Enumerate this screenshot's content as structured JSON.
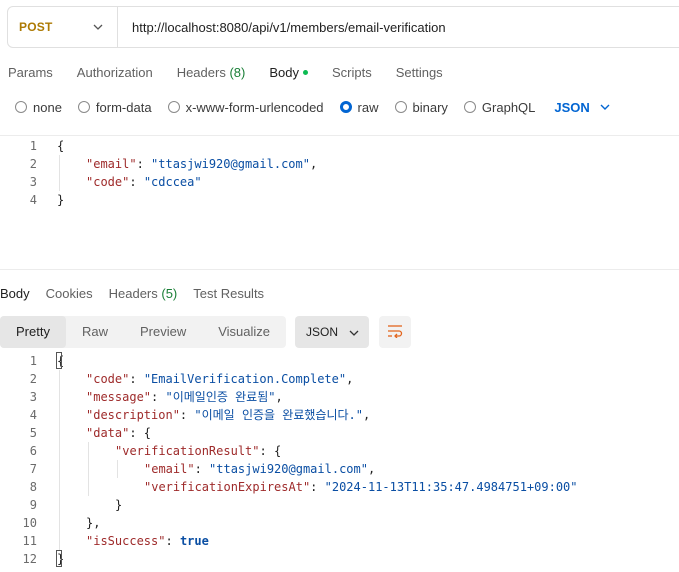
{
  "request": {
    "method": "POST",
    "url": "http://localhost:8080/api/v1/members/email-verification"
  },
  "request_tabs": [
    {
      "label": "Params",
      "active": false
    },
    {
      "label": "Authorization",
      "active": false
    },
    {
      "label": "Headers",
      "count": "(8)",
      "active": false
    },
    {
      "label": "Body",
      "active": true
    },
    {
      "label": "Scripts",
      "active": false
    },
    {
      "label": "Settings",
      "active": false
    }
  ],
  "body_types": [
    {
      "label": "none",
      "checked": false
    },
    {
      "label": "form-data",
      "checked": false
    },
    {
      "label": "x-www-form-urlencoded",
      "checked": false
    },
    {
      "label": "raw",
      "checked": true
    },
    {
      "label": "binary",
      "checked": false
    },
    {
      "label": "GraphQL",
      "checked": false
    }
  ],
  "body_language": "JSON",
  "request_body_lines": [
    {
      "num": "1",
      "indent": 0,
      "tokens": [
        {
          "t": "p",
          "v": "{"
        }
      ]
    },
    {
      "num": "2",
      "indent": 1,
      "tokens": [
        {
          "t": "k",
          "v": "\"email\""
        },
        {
          "t": "p",
          "v": ": "
        },
        {
          "t": "s",
          "v": "\"ttasjwi920@gmail.com\""
        },
        {
          "t": "p",
          "v": ","
        }
      ]
    },
    {
      "num": "3",
      "indent": 1,
      "tokens": [
        {
          "t": "k",
          "v": "\"code\""
        },
        {
          "t": "p",
          "v": ": "
        },
        {
          "t": "s",
          "v": "\"cdccea\""
        }
      ]
    },
    {
      "num": "4",
      "indent": 0,
      "tokens": [
        {
          "t": "p",
          "v": "}"
        }
      ]
    }
  ],
  "response_tabs": [
    {
      "label": "Body",
      "active": true
    },
    {
      "label": "Cookies",
      "active": false
    },
    {
      "label": "Headers",
      "count": "(5)",
      "active": false
    },
    {
      "label": "Test Results",
      "active": false
    }
  ],
  "response_views": [
    {
      "label": "Pretty",
      "active": true
    },
    {
      "label": "Raw",
      "active": false
    },
    {
      "label": "Preview",
      "active": false
    },
    {
      "label": "Visualize",
      "active": false
    }
  ],
  "response_format": "JSON",
  "response_body_lines": [
    {
      "num": "1",
      "indent": 0,
      "tokens": [
        {
          "t": "p",
          "v": "{"
        }
      ]
    },
    {
      "num": "2",
      "indent": 1,
      "tokens": [
        {
          "t": "k",
          "v": "\"code\""
        },
        {
          "t": "p",
          "v": ": "
        },
        {
          "t": "s",
          "v": "\"EmailVerification.Complete\""
        },
        {
          "t": "p",
          "v": ","
        }
      ]
    },
    {
      "num": "3",
      "indent": 1,
      "tokens": [
        {
          "t": "k",
          "v": "\"message\""
        },
        {
          "t": "p",
          "v": ": "
        },
        {
          "t": "s",
          "v": "\"이메일인증 완료됨\""
        },
        {
          "t": "p",
          "v": ","
        }
      ]
    },
    {
      "num": "4",
      "indent": 1,
      "tokens": [
        {
          "t": "k",
          "v": "\"description\""
        },
        {
          "t": "p",
          "v": ": "
        },
        {
          "t": "s",
          "v": "\"이메일 인증을 완료했습니다.\""
        },
        {
          "t": "p",
          "v": ","
        }
      ]
    },
    {
      "num": "5",
      "indent": 1,
      "tokens": [
        {
          "t": "k",
          "v": "\"data\""
        },
        {
          "t": "p",
          "v": ": {"
        }
      ]
    },
    {
      "num": "6",
      "indent": 2,
      "tokens": [
        {
          "t": "k",
          "v": "\"verificationResult\""
        },
        {
          "t": "p",
          "v": ": {"
        }
      ]
    },
    {
      "num": "7",
      "indent": 3,
      "tokens": [
        {
          "t": "k",
          "v": "\"email\""
        },
        {
          "t": "p",
          "v": ": "
        },
        {
          "t": "s",
          "v": "\"ttasjwi920@gmail.com\""
        },
        {
          "t": "p",
          "v": ","
        }
      ]
    },
    {
      "num": "8",
      "indent": 3,
      "tokens": [
        {
          "t": "k",
          "v": "\"verificationExpiresAt\""
        },
        {
          "t": "p",
          "v": ": "
        },
        {
          "t": "s",
          "v": "\"2024-11-13T11:35:47.4984751+09:00\""
        }
      ]
    },
    {
      "num": "9",
      "indent": 2,
      "tokens": [
        {
          "t": "p",
          "v": "}"
        }
      ]
    },
    {
      "num": "10",
      "indent": 1,
      "tokens": [
        {
          "t": "p",
          "v": "},"
        }
      ]
    },
    {
      "num": "11",
      "indent": 1,
      "tokens": [
        {
          "t": "k",
          "v": "\"isSuccess\""
        },
        {
          "t": "p",
          "v": ": "
        },
        {
          "t": "bool",
          "v": "true"
        }
      ]
    },
    {
      "num": "12",
      "indent": 0,
      "tokens": [
        {
          "t": "p",
          "v": "}"
        }
      ]
    }
  ],
  "icons": {
    "method_dropdown": "chevron-down-icon",
    "language_dropdown": "chevron-down-icon",
    "format_dropdown": "chevron-down-icon",
    "wrap": "wrap-lines-icon"
  },
  "colors": {
    "method": "#ad7a03",
    "accent": "#0265d2",
    "key": "#9e2a2a",
    "string": "#0a4ea3",
    "active_dot": "#0cbb52",
    "wrap_icon": "#e3651d"
  }
}
